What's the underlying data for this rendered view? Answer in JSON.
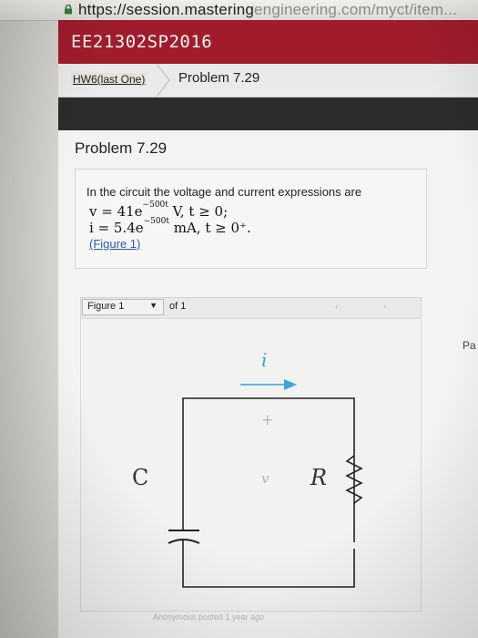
{
  "browser": {
    "url_main": "https://session.mastering",
    "url_dim": "engineering.com/myct/item..."
  },
  "course": {
    "title": "EE21302SP2016"
  },
  "breadcrumb": {
    "parent": "HW6(last One)",
    "current": "Problem 7.29"
  },
  "problem": {
    "title": "Problem 7.29",
    "intro": "In the circuit the voltage and current expressions are",
    "eq_v": "v = 41e",
    "eq_v_exp": "−500t",
    "eq_v_tail": " V, t ≥ 0;",
    "eq_i": "i = 5.4e",
    "eq_i_exp": "−500t",
    "eq_i_tail": " mA, t ≥ 0⁺.",
    "figure_link": "(Figure 1)"
  },
  "figure_toolbar": {
    "select_value": "Figure 1",
    "of_label": "of 1",
    "prev": "‹",
    "next": "›"
  },
  "circuit": {
    "current_label": "i",
    "plus": "+",
    "voltage_label": "v",
    "cap_label": "C",
    "res_label": "R"
  },
  "side_text": "Pa",
  "footer": "Anonymous posted 1 year ago",
  "colors": {
    "course_bar": "#a01c2d",
    "current_arrow": "#3aa6e0"
  }
}
